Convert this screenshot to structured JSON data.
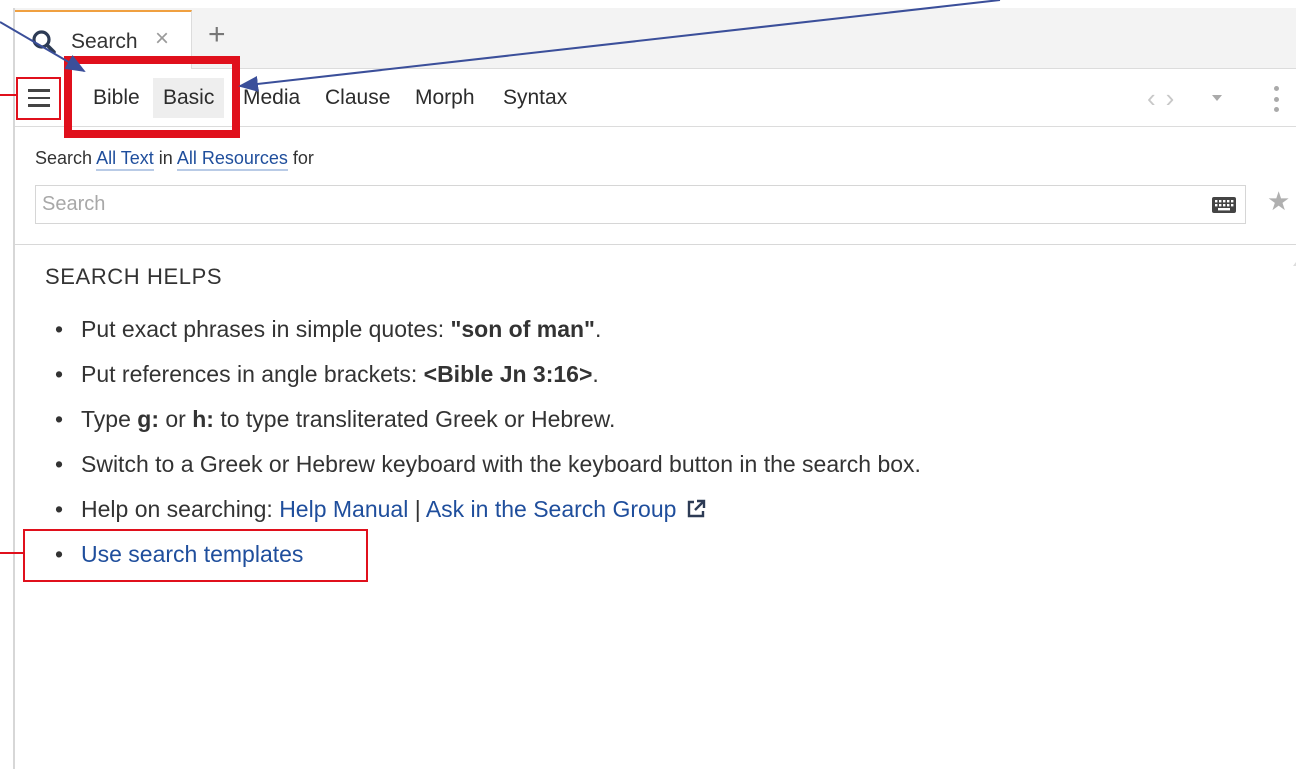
{
  "tab": {
    "label": "Search",
    "close_glyph": "×",
    "new_tab_glyph": "+"
  },
  "toolbar": {
    "menu_icon": "hamburger-menu-icon",
    "modes": [
      {
        "label": "Bible",
        "selected": false
      },
      {
        "label": "Basic",
        "selected": true
      },
      {
        "label": "Media",
        "selected": false
      },
      {
        "label": "Clause",
        "selected": false
      },
      {
        "label": "Morph",
        "selected": false
      },
      {
        "label": "Syntax",
        "selected": false
      }
    ],
    "back_glyph": "‹",
    "forward_glyph": "›"
  },
  "search_scope": {
    "prefix": "Search",
    "what_link": "All Text",
    "in_word": "in",
    "where_link": "All Resources",
    "suffix": "for"
  },
  "search_input": {
    "placeholder": "Search",
    "value": ""
  },
  "helps": {
    "heading": "SEARCH HELPS",
    "item1": {
      "text": "Put exact phrases in simple quotes: ",
      "bold": "\"son of man\"",
      "end": "."
    },
    "item2": {
      "text": "Put references in angle brackets: ",
      "bold": "<Bible Jn 3:16>",
      "end": "."
    },
    "item3": {
      "t1": "Type ",
      "b1": "g:",
      "t2": " or ",
      "b2": "h:",
      "t3": " to type transliterated Greek or Hebrew."
    },
    "item4": {
      "text": "Switch to a Greek or Hebrew keyboard with the keyboard button in the search box."
    },
    "item5": {
      "text": "Help on searching: ",
      "link1": "Help Manual",
      "sep": " | ",
      "link2": "Ask in the Search Group"
    },
    "item6": {
      "link": "Use search templates"
    }
  },
  "colors": {
    "annotation": "#e0101c",
    "arrow": "#3b4f9a",
    "link": "#1f4e9c",
    "tab_accent": "#f0a040"
  }
}
